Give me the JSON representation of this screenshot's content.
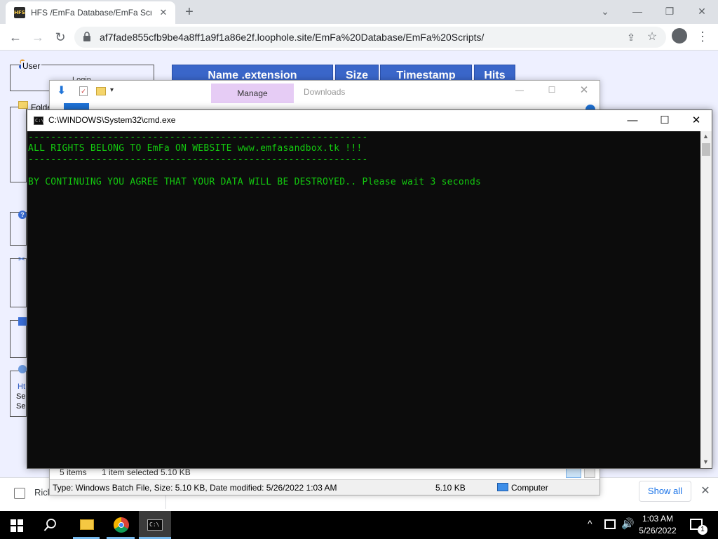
{
  "browser": {
    "tab_title": "HFS /EmFa Database/EmFa Scripts/",
    "tab_close": "✕",
    "new_tab": "+",
    "url": "af7fade855cfb9be4a8ff1a9f1a86e2f.loophole.site/EmFa%20Database/EmFa%20Scripts/",
    "window_controls": {
      "dropdown": "⌄",
      "minimize": "—",
      "restore": "❐",
      "close": "✕"
    },
    "nav": {
      "back": "←",
      "forward": "→",
      "reload": "↻"
    },
    "share": "⇪",
    "star": "☆",
    "menu": "⋮"
  },
  "hfs": {
    "user_label": "User",
    "login_text": "Login",
    "folder_label": "Folde",
    "side_ht": "Ht",
    "side_se1": "Se",
    "side_se2": "Se",
    "table_headers": [
      "Name .extension",
      "Size",
      "Timestamp",
      "Hits"
    ]
  },
  "explorer": {
    "title": "Downloads",
    "manage_tab": "Manage",
    "status_count": "5 items",
    "status_selected": "1 item selected  5.10 KB",
    "details_text": "Type: Windows Batch File, Size: 5.10 KB, Date modified: 5/26/2022 1:03 AM",
    "details_size": "5.10 KB",
    "details_location": "Computer",
    "controls": {
      "minimize": "—",
      "maximize": "☐",
      "close": "✕"
    }
  },
  "cmd": {
    "title": "C:\\WINDOWS\\System32\\cmd.exe",
    "controls": {
      "minimize": "—",
      "maximize": "☐",
      "close": "✕"
    },
    "lines": [
      "------------------------------------------------------------",
      "ALL RIGHTS BELONG TO EmFa ON WEBSITE www.emfasandbox.tk !!!",
      "------------------------------------------------------------",
      "",
      "BY CONTINUING YOU AGREE THAT YOUR DATA WILL BE DESTROYED.. Please wait 3 seconds"
    ],
    "text_color": "#13c90f"
  },
  "downloads_bar": {
    "file_name": "Rick",
    "show_all": "Show all",
    "close": "✕"
  },
  "taskbar": {
    "chevron": "^",
    "volume": "🔊",
    "time": "1:03 AM",
    "date": "5/26/2022",
    "notification_count": "1",
    "cmd_glyph": "C:\\"
  }
}
